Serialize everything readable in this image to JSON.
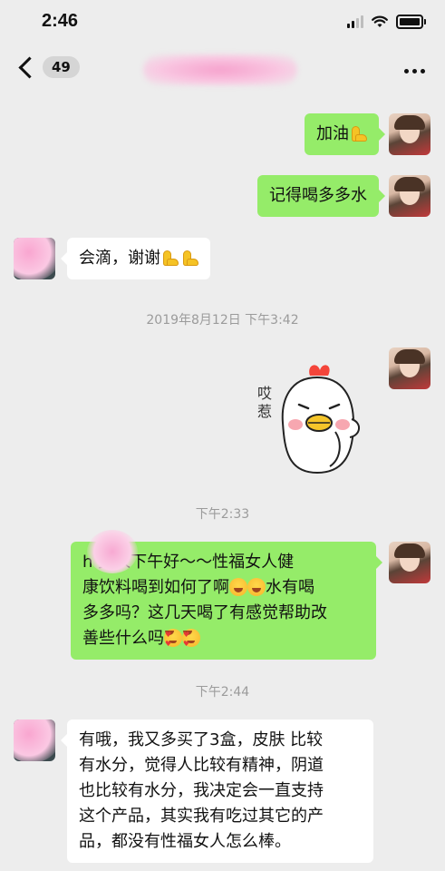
{
  "status_bar": {
    "time": "2:46"
  },
  "nav": {
    "unread_count": "49"
  },
  "messages": [
    {
      "sender": "self",
      "text": "加油",
      "emojis": [
        "muscle-emoji"
      ]
    },
    {
      "sender": "self",
      "text": "记得喝多多水"
    },
    {
      "sender": "peer",
      "text": "会滴，谢谢",
      "emojis": [
        "muscle-emoji",
        "muscle-emoji"
      ]
    },
    {
      "type": "timestamp",
      "text": "2019年8月12日 下午3:42"
    },
    {
      "sender": "self",
      "type": "sticker",
      "text": "哎惹"
    },
    {
      "type": "timestamp",
      "text": "下午2:33"
    },
    {
      "sender": "self",
      "line1": "h   美人下午好～～性福女人健",
      "line2": "康饮料喝到如何了啊",
      "line2b": "水有喝",
      "line3": "多多吗？这几天喝了有感觉帮助改",
      "line4": "善些什么吗"
    },
    {
      "type": "timestamp",
      "text": "下午2:44"
    },
    {
      "sender": "peer",
      "lines": [
        "有哦，我又多买了3盒，皮肤 比较",
        "有水分，觉得人比较有精神，阴道",
        "也比较有水分，我决定会一直支持",
        "这个产品，其实我有吃过其它的产",
        "品，都没有性福女人怎么棒。"
      ]
    }
  ]
}
